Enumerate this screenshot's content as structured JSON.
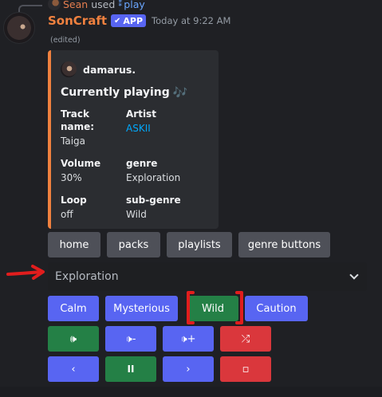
{
  "reply": {
    "user": "Sean",
    "used_text": "used",
    "command": "play",
    "command_icon": "slash-command-icon"
  },
  "message": {
    "username": "SonCraft",
    "app_badge": "APP",
    "timestamp": "Today at 9:22 AM",
    "edited": "(edited)"
  },
  "embed": {
    "accent_color": "#f0813f",
    "author": "damarus.",
    "title": "Currently playing",
    "title_icon": "🎶",
    "fields": [
      {
        "name": "Track name:",
        "value": "Taiga"
      },
      {
        "name": "Artist",
        "value": "ASKII"
      },
      {
        "name": "Volume",
        "value": "30%"
      },
      {
        "name": "genre",
        "value": "Exploration"
      },
      {
        "name": "Loop",
        "value": "off"
      },
      {
        "name": "sub-genre",
        "value": "Wild"
      }
    ]
  },
  "nav_buttons": [
    "home",
    "packs",
    "playlists",
    "genre buttons"
  ],
  "genre_select": {
    "selected": "Exploration"
  },
  "subgenre_buttons": [
    "Calm",
    "Mysterious",
    "Wild",
    "Caution"
  ],
  "controls_row1": [
    {
      "icon": "🕪",
      "name": "volume-icon"
    },
    {
      "icon": "🕩-",
      "name": "volume-down-icon"
    },
    {
      "icon": "🕩+",
      "name": "volume-up-icon"
    },
    {
      "icon": "⤮",
      "name": "shuffle-icon"
    }
  ],
  "controls_row2": [
    {
      "icon": "‹",
      "name": "previous-icon"
    },
    {
      "icon": "II",
      "name": "pause-icon"
    },
    {
      "icon": "›",
      "name": "next-icon"
    },
    {
      "icon": "▫",
      "name": "stop-icon"
    }
  ],
  "colors": {
    "grey": "#4e5058",
    "blurple": "#5865f2",
    "green": "#248046",
    "red": "#da373c",
    "annotation_red": "#e11d1d"
  }
}
